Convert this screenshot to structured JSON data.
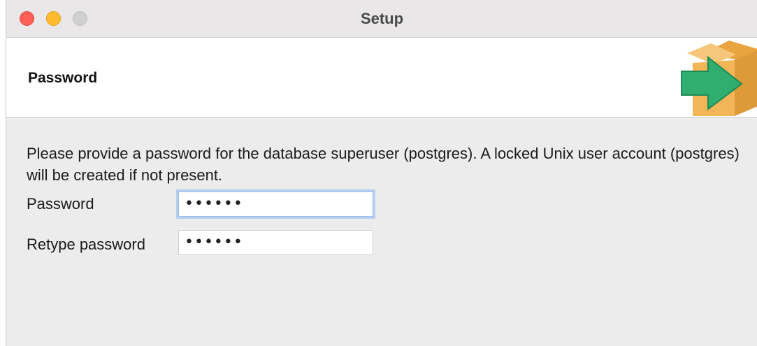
{
  "window": {
    "title": "Setup"
  },
  "header": {
    "title": "Password",
    "logo_icon": "box-arrow-icon"
  },
  "content": {
    "intro_text": "Please provide a password for the database superuser (postgres). A locked Unix user account (postgres) will be created if not present.",
    "fields": [
      {
        "label": "Password",
        "value": "••••••",
        "focused": true
      },
      {
        "label": "Retype password",
        "value": "••••••",
        "focused": false
      }
    ]
  },
  "colors": {
    "close": "#fe5f57",
    "minimize": "#febc2e",
    "zoom": "#d0d0d0",
    "focus_ring": "#b7cff0",
    "box": "#f2b659",
    "arrow": "#2fae6f"
  }
}
